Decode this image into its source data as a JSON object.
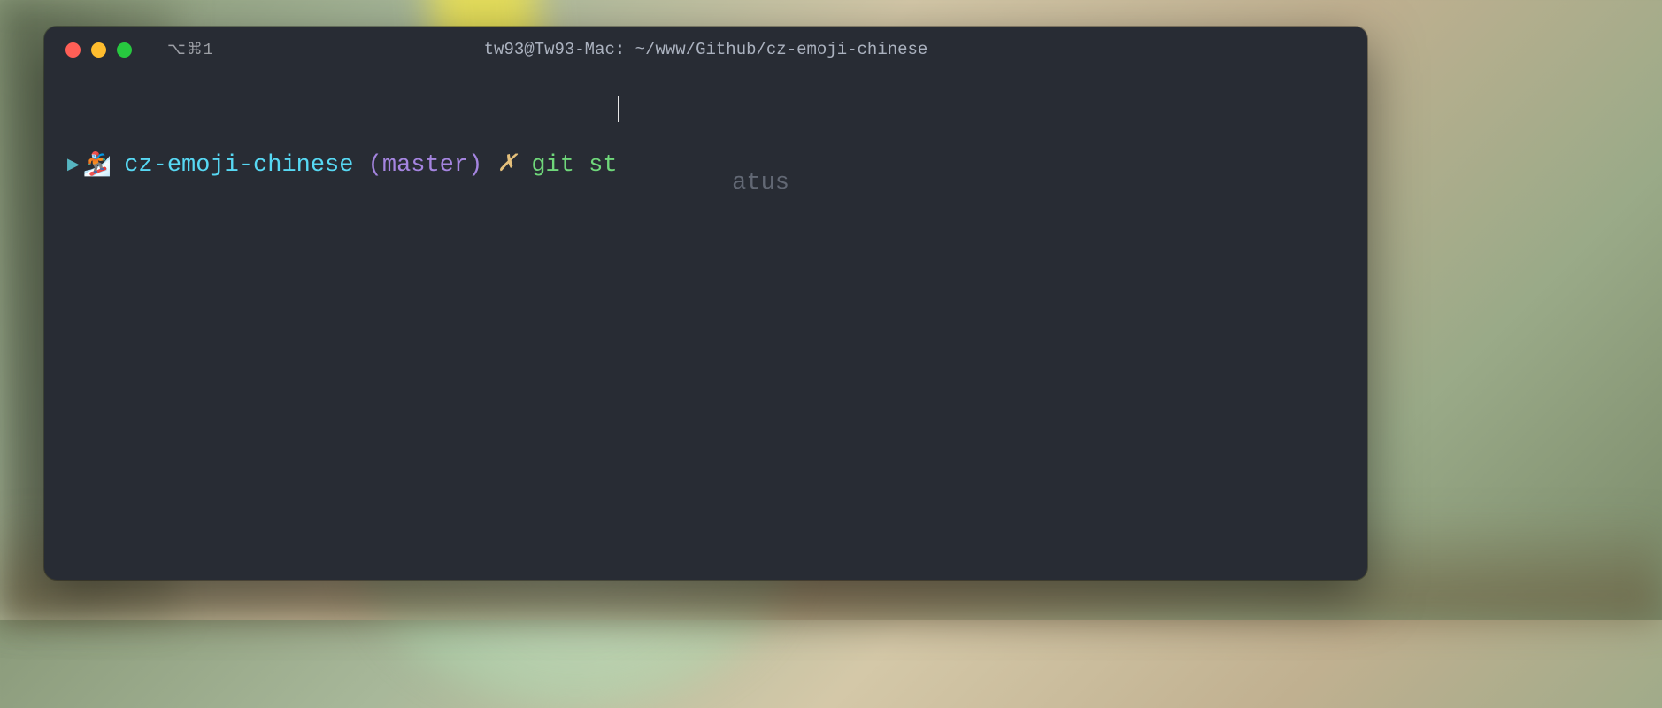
{
  "window": {
    "title": "tw93@Tw93-Mac: ~/www/Github/cz-emoji-chinese",
    "tab_indicator": "⌥⌘1"
  },
  "prompt": {
    "arrow": "▶",
    "emoji": "🏂",
    "directory": "cz-emoji-chinese",
    "branch_open": " (",
    "branch_name": "master",
    "branch_close": ") ",
    "status_symbol": "✗",
    "separator": " "
  },
  "command": {
    "typed": "git st",
    "suggestion": "atus"
  },
  "colors": {
    "background": "#282c34",
    "foreground": "#abb2bf",
    "directory": "#57d8f3",
    "branch": "#a585e0",
    "status": "#e5c07b",
    "command": "#6fd77a",
    "suggestion": "#626874",
    "traffic_red": "#ff5f56",
    "traffic_yellow": "#ffbd2e",
    "traffic_green": "#27c93f"
  }
}
